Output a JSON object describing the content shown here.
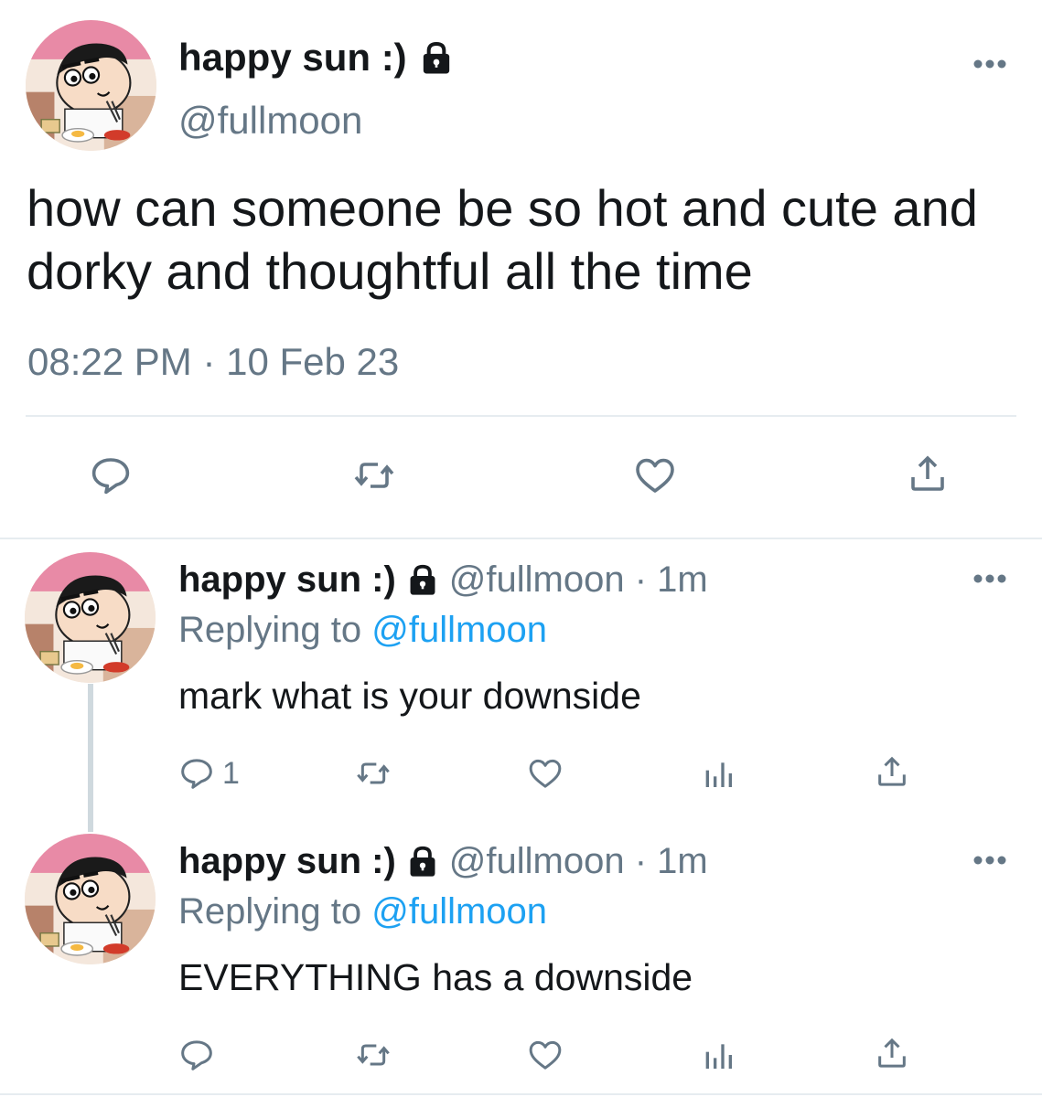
{
  "main_tweet": {
    "display_name": "happy sun :)",
    "handle": "@fullmoon",
    "text": "how can someone be so hot and cute and dorky and thoughtful all the time",
    "timestamp": "08:22 PM · 10 Feb 23",
    "icons": [
      "lock-icon",
      "more-icon",
      "reply-icon",
      "retweet-icon",
      "like-icon",
      "share-icon"
    ]
  },
  "replies": [
    {
      "display_name": "happy sun :)",
      "handle_time": "@fullmoon · 1m",
      "replying_prefix": "Replying to",
      "replying_to": "@fullmoon",
      "text": "mark what is your downside",
      "reply_count": "1",
      "icons": [
        "reply-icon",
        "retweet-icon",
        "like-icon",
        "analytics-icon",
        "share-icon"
      ]
    },
    {
      "display_name": "happy sun :)",
      "handle_time": "@fullmoon · 1m",
      "replying_prefix": "Replying to",
      "replying_to": "@fullmoon",
      "text": "EVERYTHING has a downside",
      "reply_count": "",
      "icons": [
        "reply-icon",
        "retweet-icon",
        "like-icon",
        "analytics-icon",
        "share-icon"
      ]
    }
  ],
  "colors": {
    "text": "#14171a",
    "secondary": "#657786",
    "link": "#1da1f2",
    "divider": "#e6ecf0",
    "thread_line": "#cfd9de"
  }
}
